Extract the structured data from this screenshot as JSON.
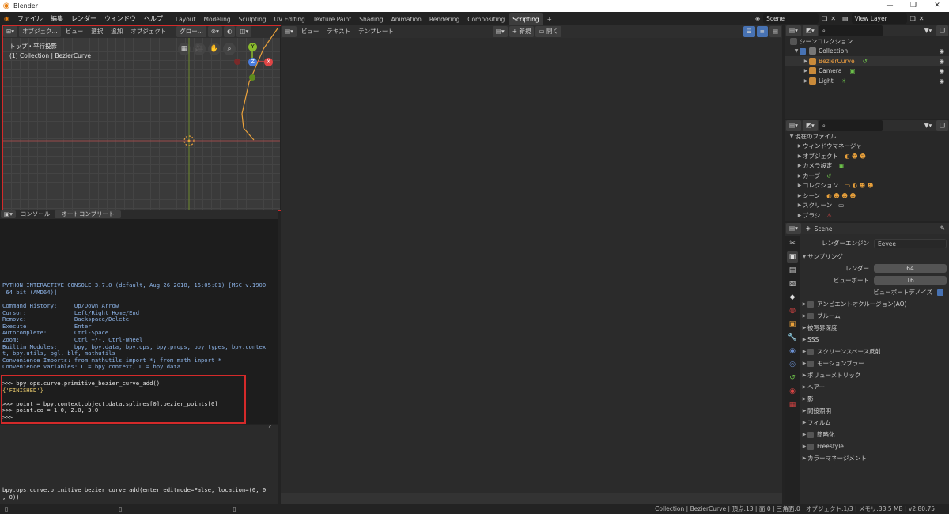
{
  "titlebar": {
    "title": "Blender",
    "minimize": "—",
    "maximize": "❐",
    "close": "✕"
  },
  "menu": [
    "ファイル",
    "編集",
    "レンダー",
    "ウィンドウ",
    "ヘルプ"
  ],
  "workspaces": [
    "Layout",
    "Modeling",
    "Sculpting",
    "UV Editing",
    "Texture Paint",
    "Shading",
    "Animation",
    "Rendering",
    "Compositing",
    "Scripting"
  ],
  "active_workspace": "Scripting",
  "add_tab": "+",
  "scene_name": "Scene",
  "view_layer": "View Layer",
  "viewport": {
    "mode": "オブジェク...",
    "menus": [
      "ビュー",
      "選択",
      "追加",
      "オブジェクト"
    ],
    "transform": "グロー...",
    "view_name": "トップ・平行投影",
    "collection_label": "(1) Collection | BezierCurve",
    "gizmo": {
      "y": "Y",
      "z": "Z",
      "x": "X"
    }
  },
  "text_editor": {
    "menus": [
      "ビュー",
      "テキスト",
      "テンプレート"
    ],
    "new_label": "新規",
    "open_label": "開く"
  },
  "console": {
    "tabs": [
      "コンソール",
      "オートコンプリート"
    ],
    "banner1": "PYTHON INTERACTIVE CONSOLE 3.7.0 (default, Aug 26 2018, 16:05:01) [MSC v.1900",
    "banner2": " 64 bit (AMD64)]",
    "help": [
      "Command History:     Up/Down Arrow",
      "Cursor:              Left/Right Home/End",
      "Remove:              Backspace/Delete",
      "Execute:             Enter",
      "Autocomplete:        Ctrl-Space",
      "Zoom:                Ctrl +/-, Ctrl-Wheel",
      "Builtin Modules:     bpy, bpy.data, bpy.ops, bpy.props, bpy.types, bpy.contex",
      "t, bpy.utils, bgl, blf, mathutils",
      "Convenience Imports: from mathutils import *; from math import *",
      "Convenience Variables: C = bpy.context, D = bpy.data"
    ],
    "cmd1": ">>> bpy.ops.curve.primitive_bezier_curve_add()",
    "result1": "{'FINISHED'}",
    "cmd2": ">>> point = bpy.context.object.data.splines[0].bezier_points[0]",
    "cmd3": ">>> point.co = 1.0, 2.0, 3.0",
    "prompt": ">>> ",
    "info1": "bpy.ops.curve.primitive_bezier_curve_add(enter_editmode=False, location=(0, 0",
    "info2": ", 0))"
  },
  "outliner": {
    "title": "シーンコレクション",
    "items": [
      {
        "label": "Collection"
      },
      {
        "label": "BezierCurve"
      },
      {
        "label": "Camera"
      },
      {
        "label": "Light"
      }
    ]
  },
  "datablocks": {
    "title": "現在のファイル",
    "items": [
      "ウィンドウマネージャ",
      "オブジェクト",
      "カメラ設定",
      "カーブ",
      "コレクション",
      "シーン",
      "スクリーン",
      "ブラシ"
    ]
  },
  "properties": {
    "scene": "Scene",
    "engine_label": "レンダーエンジン",
    "engine_value": "Eevee",
    "sampling": "サンプリング",
    "render_label": "レンダー",
    "render_value": "64",
    "viewport_label": "ビューポート",
    "viewport_value": "16",
    "denoise_label": "ビューポートデノイズ",
    "panels": [
      {
        "label": "アンビエントオクルージョン(AO)",
        "check": true
      },
      {
        "label": "ブルーム",
        "check": true
      },
      {
        "label": "被写界深度",
        "check": false
      },
      {
        "label": "SSS",
        "check": false
      },
      {
        "label": "スクリーンスペース反射",
        "check": true
      },
      {
        "label": "モーションブラー",
        "check": true
      },
      {
        "label": "ボリューメトリック",
        "check": false
      },
      {
        "label": "ヘアー",
        "check": false
      },
      {
        "label": "影",
        "check": false
      },
      {
        "label": "間接照明",
        "check": false
      },
      {
        "label": "フィルム",
        "check": false
      },
      {
        "label": "簡略化",
        "check": true
      },
      {
        "label": "Freestyle",
        "check": true
      },
      {
        "label": "カラーマネージメント",
        "check": false
      }
    ]
  },
  "statusbar": "Collection | BezierCurve | 頂点:13 | 面:0 | 三角面:0 | オブジェクト:1/3 | メモリ:33.5 MB | v2.80.75"
}
